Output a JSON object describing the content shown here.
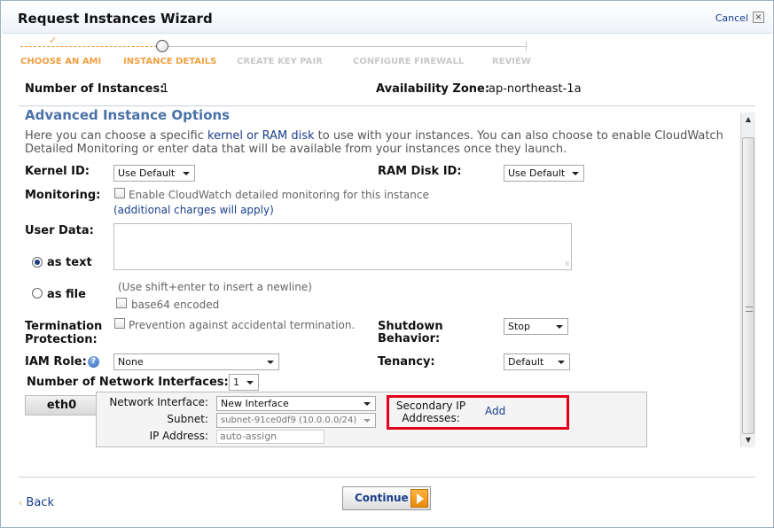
{
  "window": {
    "title": "Request Instances Wizard",
    "cancel_label": "Cancel",
    "close_glyph": "×"
  },
  "steps": {
    "check_glyph": "✓",
    "items": [
      {
        "label": "CHOOSE AN AMI",
        "state": "done"
      },
      {
        "label": "INSTANCE DETAILS",
        "state": "current"
      },
      {
        "label": "CREATE KEY PAIR",
        "state": "todo"
      },
      {
        "label": "CONFIGURE FIREWALL",
        "state": "todo"
      },
      {
        "label": "REVIEW",
        "state": "todo"
      }
    ]
  },
  "summary": {
    "instances_label": "Number of Instances:",
    "instances_value": "1",
    "zone_label": "Availability Zone:",
    "zone_value": "ap-northeast-1a"
  },
  "advanced": {
    "title": "Advanced Instance Options",
    "intro_before_link": "Here you can choose a specific ",
    "intro_link": "kernel or RAM disk",
    "intro_after_link": " to use with your instances. You can also choose to enable CloudWatch Detailed Monitoring or enter data that will be available from your instances once they launch.",
    "kernel_label": "Kernel ID:",
    "kernel_value": "Use Default",
    "ramdisk_label": "RAM Disk ID:",
    "ramdisk_value": "Use Default",
    "monitoring_label": "Monitoring:",
    "monitoring_checkbox_text": "Enable CloudWatch detailed monitoring for this instance",
    "monitoring_note": "(additional charges will apply)",
    "userdata_label": "User Data:",
    "as_text_label": "as text",
    "as_file_label": "as file",
    "userdata_hint": "(Use shift+enter to insert a newline)",
    "base64_label": "base64 encoded",
    "termination_label_1": "Termination",
    "termination_label_2": "Protection:",
    "termination_checkbox_text": "Prevention against accidental termination.",
    "shutdown_label_1": "Shutdown",
    "shutdown_label_2": "Behavior:",
    "shutdown_value": "Stop",
    "iam_label": "IAM Role:",
    "iam_value": "None",
    "help_glyph": "?",
    "tenancy_label": "Tenancy:",
    "tenancy_value": "Default",
    "nic_count_label": "Number of Network Interfaces:",
    "nic_count_value": "1"
  },
  "nic": {
    "tab_label": "eth0",
    "interface_label": "Network Interface:",
    "interface_value": "New Interface",
    "subnet_label": "Subnet:",
    "subnet_value": "subnet-91ce0df9 (10.0.0.0/24)",
    "ip_label": "IP Address:",
    "ip_placeholder": "auto-assign",
    "secondary_label": "Secondary IP Addresses:",
    "secondary_add": "Add"
  },
  "footer": {
    "back_glyph": "‹",
    "back_label": "Back",
    "continue_label": "Continue"
  },
  "colors": {
    "accent_orange": "#f0a040",
    "link_blue": "#1a3e8c",
    "section_blue": "#4a72a8",
    "highlight_red": "#e3001b"
  }
}
